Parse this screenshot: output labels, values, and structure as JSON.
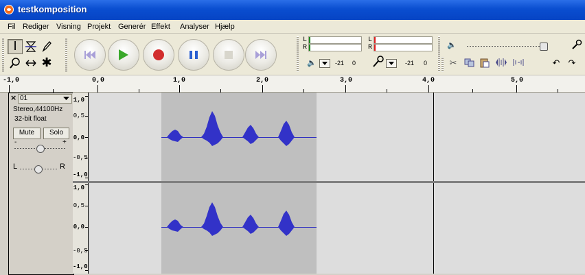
{
  "window": {
    "title": "testkomposition"
  },
  "menu": [
    "Fil",
    "Rediger",
    "Visning",
    "Projekt",
    "Generér",
    "Effekt",
    "Analyser",
    "Hjælp"
  ],
  "tools": {
    "row1": [
      "selection-tool-icon",
      "envelope-tool-icon",
      "draw-tool-icon"
    ],
    "row2": [
      "zoom-tool-icon",
      "timeshift-tool-icon",
      "multi-tool-icon"
    ]
  },
  "transport": [
    "skip-start-icon",
    "play-icon",
    "record-icon",
    "pause-icon",
    "stop-icon",
    "skip-end-icon"
  ],
  "meters": {
    "output": {
      "left_label": "L",
      "right_label": "R",
      "scale_min": "-21",
      "scale_max": "0"
    },
    "input": {
      "left_label": "L",
      "right_label": "R",
      "scale_min": "-21",
      "scale_max": "0"
    }
  },
  "ruler": {
    "labels": [
      "-1,0",
      "0,0",
      "1,0",
      "2,0",
      "3,0",
      "4,0",
      "5,0"
    ]
  },
  "tracks": [
    {
      "name": "01",
      "format": "Stereo,44100Hz",
      "bitdepth": "32-bit float",
      "mute_label": "Mute",
      "solo_label": "Solo",
      "gain_minus": "-",
      "gain_plus": "+",
      "pan_left": "L",
      "pan_right": "R",
      "scale_labels": [
        "1,0",
        "0,5",
        "0,0",
        "-0,5",
        "-1,0"
      ]
    },
    {
      "scale_labels": [
        "1,0",
        "0,5",
        "0,0",
        "-0,5",
        "-1,0"
      ]
    }
  ],
  "colors": {
    "titlebar": "#0a4ed0",
    "waveform": "#3232c8",
    "selection": "#bfbfbf",
    "meter_green": "#1b8a1b",
    "meter_red": "#e02020"
  }
}
